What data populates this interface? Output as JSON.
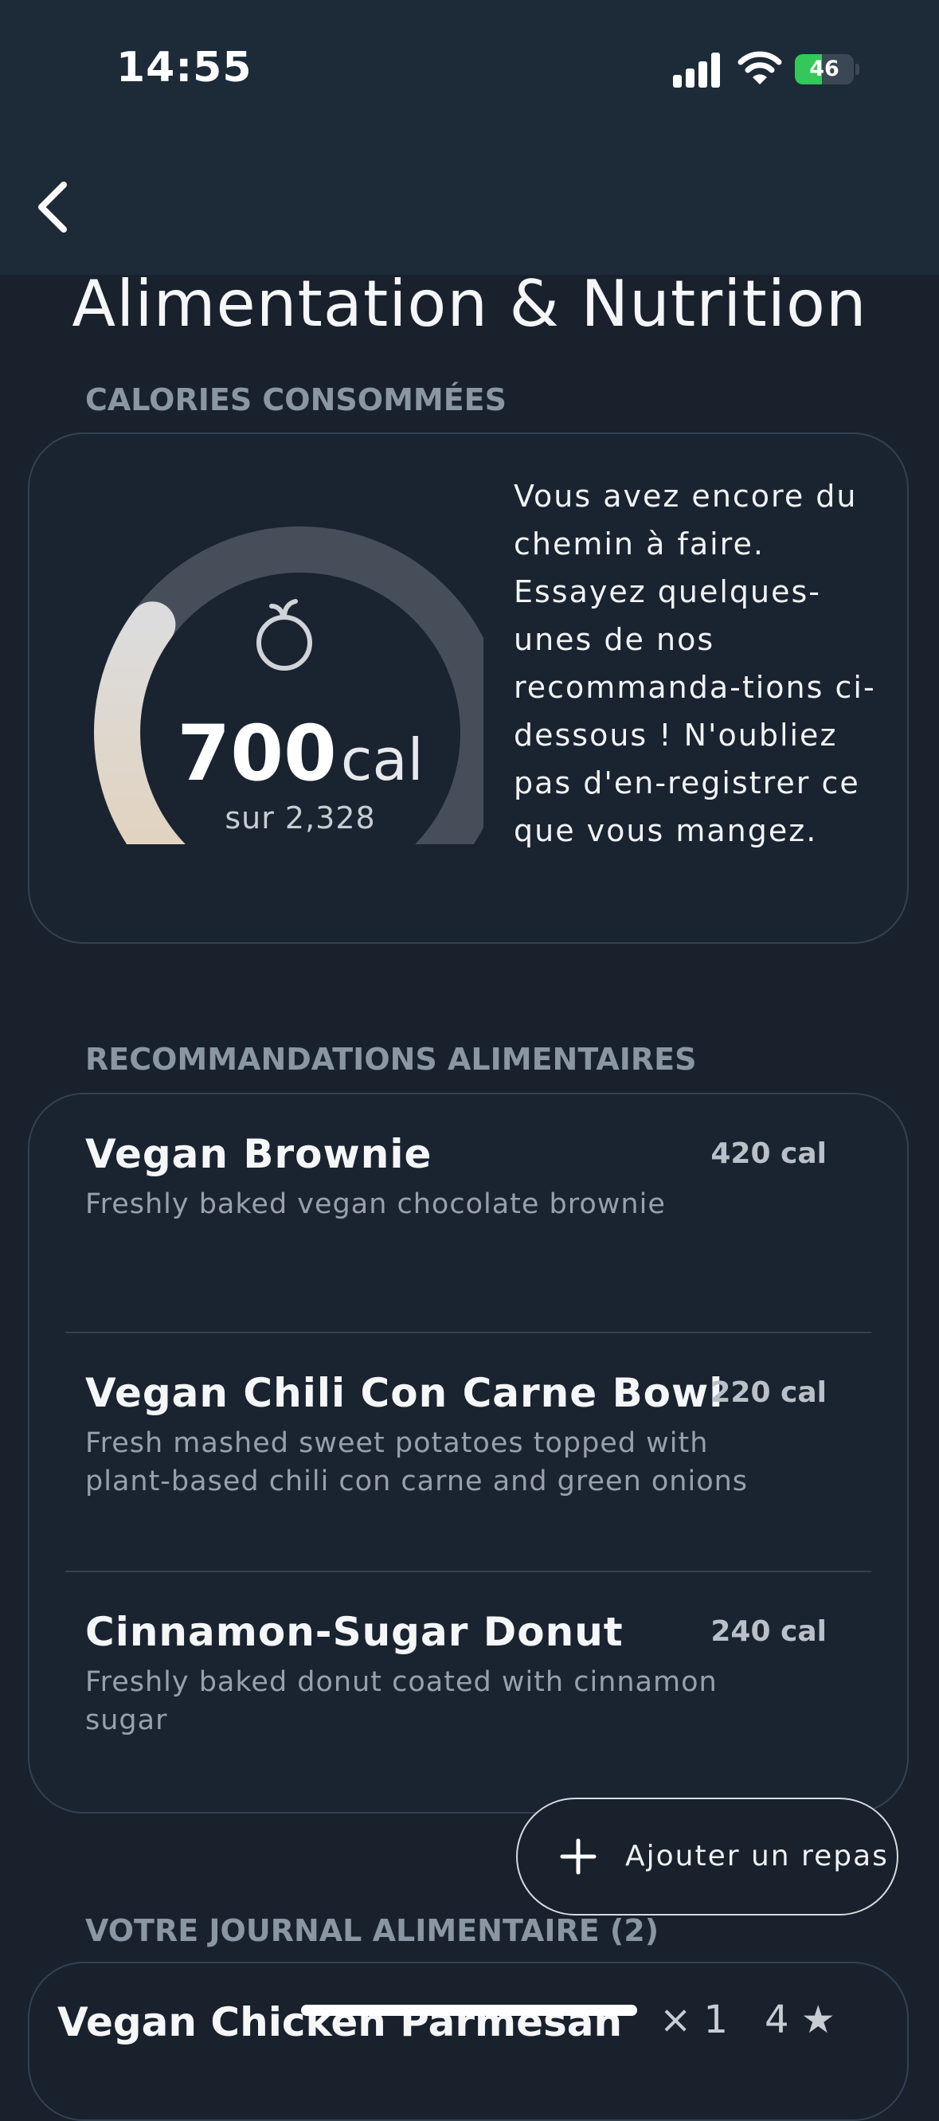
{
  "status_bar": {
    "time": "14:55",
    "battery": "46",
    "battery_fraction": 0.46
  },
  "header": {
    "title": "Alimentation & Nutrition"
  },
  "calories": {
    "section_label": "CALORIES CONSOMMÉES",
    "consumed": "700",
    "unit": "cal",
    "goal_text": "sur 2,328",
    "consumed_value": 700,
    "goal_value": 2328,
    "advice": "Vous avez encore du chemin à faire. Essayez quelques-unes de nos recommanda-tions ci-dessous ! N'oubliez pas d'en-registrer ce que vous mangez."
  },
  "recommendations": {
    "section_label": "RECOMMANDATIONS ALIMENTAIRES",
    "items": [
      {
        "name": "Vegan Brownie",
        "calories": "420 cal",
        "description": "Freshly baked vegan chocolate brownie"
      },
      {
        "name": "Vegan Chili Con Carne Bowl",
        "calories": "220 cal",
        "description": "Fresh mashed sweet potatoes topped with plant-based chili con carne and green onions"
      },
      {
        "name": "Cinnamon-Sugar Donut",
        "calories": "240 cal",
        "description": "Freshly baked donut coated with cinnamon sugar"
      }
    ]
  },
  "add_meal": {
    "label": "Ajouter un repas"
  },
  "journal": {
    "section_label": "VOTRE JOURNAL ALIMENTAIRE (2)",
    "items": [
      {
        "name": "Vegan Chicken Parmesan",
        "quantity": "× 1",
        "rating": "4 ★"
      }
    ]
  },
  "colors": {
    "background": "#18212c",
    "gauge_track": "#464f59",
    "gauge_fill_start": "#e3ddd4",
    "battery_green": "#34c759"
  }
}
